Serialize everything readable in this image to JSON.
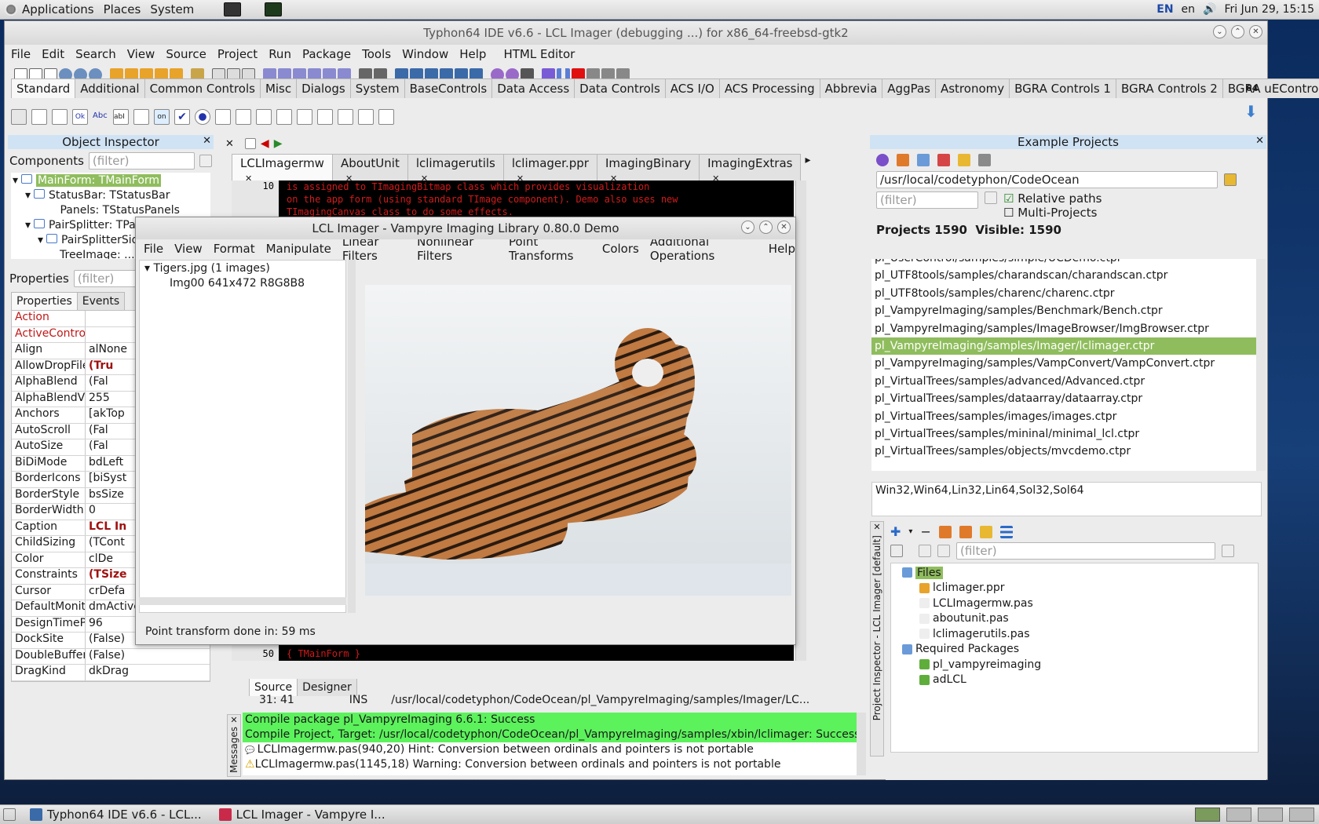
{
  "top_panel": {
    "menu": [
      "Applications",
      "Places",
      "System"
    ],
    "lang1": "EN",
    "lang2": "en",
    "clock": "Fri Jun 29, 15:15"
  },
  "ide": {
    "title": "Typhon64 IDE v6.6 - LCL Imager (debugging ...) for x86_64-freebsd-gtk2",
    "menu": [
      "File",
      "Edit",
      "Search",
      "View",
      "Source",
      "Project",
      "Run",
      "Package",
      "Tools",
      "Window",
      "Help",
      "HTML Editor"
    ],
    "component_tabs": [
      "Standard",
      "Additional",
      "Common Controls",
      "Misc",
      "Dialogs",
      "System",
      "BaseControls",
      "Data Access",
      "Data Controls",
      "ACS I/O",
      "ACS Processing",
      "Abbrevia",
      "AggPas",
      "Astronomy",
      "BGRA Controls 1",
      "BGRA Controls 2",
      "BGRA uEControls"
    ],
    "palette_labels": [
      "Ok",
      "Abc",
      "abI",
      "on"
    ],
    "badge64": "64"
  },
  "object_inspector": {
    "title": "Object Inspector",
    "components_label": "Components",
    "filter_placeholder": "(filter)",
    "tree": [
      "MainForm: TMainForm",
      "StatusBar: TStatusBar",
      "Panels: TStatusPanels",
      "PairSplitter: TPai",
      "PairSplitterSid",
      "TreeImage: ..."
    ],
    "properties_label": "Properties",
    "tabs": [
      "Properties",
      "Events"
    ],
    "props": [
      {
        "n": "Action",
        "v": ""
      },
      {
        "n": "ActiveControl",
        "v": ""
      },
      {
        "n": "Align",
        "v": "alNone"
      },
      {
        "n": "AllowDropFiles",
        "v": "(Tru"
      },
      {
        "n": "AlphaBlend",
        "v": "(Fal"
      },
      {
        "n": "AlphaBlendVal",
        "v": "255"
      },
      {
        "n": "Anchors",
        "v": "[akTop"
      },
      {
        "n": "AutoScroll",
        "v": "(Fal"
      },
      {
        "n": "AutoSize",
        "v": "(Fal"
      },
      {
        "n": "BiDiMode",
        "v": "bdLeft"
      },
      {
        "n": "BorderIcons",
        "v": "[biSyst"
      },
      {
        "n": "BorderStyle",
        "v": "bsSize"
      },
      {
        "n": "BorderWidth",
        "v": "0"
      },
      {
        "n": "Caption",
        "v": "LCL In"
      },
      {
        "n": "ChildSizing",
        "v": "(TCont"
      },
      {
        "n": "Color",
        "v": "clDe"
      },
      {
        "n": "Constraints",
        "v": "(TSize"
      },
      {
        "n": "Cursor",
        "v": "crDefa"
      },
      {
        "n": "DefaultMonito",
        "v": "dmActiveForm"
      },
      {
        "n": "DesignTimePP",
        "v": "96"
      },
      {
        "n": "DockSite",
        "v": "(False)"
      },
      {
        "n": "DoubleBuffere",
        "v": "(False)"
      },
      {
        "n": "DragKind",
        "v": "dkDrag"
      }
    ]
  },
  "editor": {
    "tabs": [
      "LCLImagermw",
      "AboutUnit",
      "lclimagerutils",
      "lclimager.ppr",
      "ImagingBinary",
      "ImagingExtras"
    ],
    "code_lines": [
      "is assigned to TImagingBitmap class which provides visualization",
      "on the app form (using standard TImage component). Demo also uses new",
      "TImagingCanvas class to do some effects."
    ],
    "line_top": "10",
    "line_bottom": "50",
    "bottom_code": "{ TMainForm }",
    "bottom_tabs": [
      "Source",
      "Designer"
    ],
    "status_pos": "31: 41",
    "status_mode": "INS",
    "status_path": "/usr/local/codetyphon/CodeOcean/pl_VampyreImaging/samples/Imager/LC..."
  },
  "imager": {
    "title": "LCL Imager - Vampyre Imaging Library 0.80.0 Demo",
    "menu": [
      "File",
      "View",
      "Format",
      "Manipulate",
      "Linear Filters",
      "Nonlinear Filters",
      "Point Transforms",
      "Colors",
      "Additional Operations",
      "Help"
    ],
    "tree_root": "Tigers.jpg (1 images)",
    "tree_child": "Img00 641x472 R8G8B8",
    "status": "Point transform done in: 59 ms"
  },
  "example_projects": {
    "title": "Example Projects",
    "path": "/usr/local/codetyphon/CodeOcean",
    "filter_placeholder": "(filter)",
    "relative_paths": "Relative paths",
    "multi_projects": "Multi-Projects",
    "counts": "Projects 1590  Visible: 1590",
    "items": [
      "pl_UserControl/samples/simple/UCDemo.ctpr",
      "pl_UTF8tools/samples/charandscan/charandscan.ctpr",
      "pl_UTF8tools/samples/charenc/charenc.ctpr",
      "pl_VampyreImaging/samples/Benchmark/Bench.ctpr",
      "pl_VampyreImaging/samples/ImageBrowser/ImgBrowser.ctpr",
      "pl_VampyreImaging/samples/Imager/lclimager.ctpr",
      "pl_VampyreImaging/samples/VampConvert/VampConvert.ctpr",
      "pl_VirtualTrees/samples/advanced/Advanced.ctpr",
      "pl_VirtualTrees/samples/dataarray/dataarray.ctpr",
      "pl_VirtualTrees/samples/images/images.ctpr",
      "pl_VirtualTrees/samples/mininal/minimal_lcl.ctpr",
      "pl_VirtualTrees/samples/objects/mvcdemo.ctpr"
    ],
    "platforms": "Win32,Win64,Lin32,Lin64,Sol32,Sol64"
  },
  "project_inspector": {
    "side_title": "Project Inspector - LCL Imager [default]",
    "filter_placeholder": "(filter)",
    "files_label": "Files",
    "files": [
      "lclimager.ppr",
      "LCLImagermw.pas",
      "aboutunit.pas",
      "lclimagerutils.pas"
    ],
    "packages_label": "Required Packages",
    "packages": [
      "pl_vampyreimaging",
      "adLCL"
    ]
  },
  "messages": {
    "side_title": "Messages",
    "lines": [
      {
        "t": "Compile package pl_VampyreImaging 6.6.1: Success",
        "k": "ok"
      },
      {
        "t": "Compile Project, Target: /usr/local/codetyphon/CodeOcean/pl_VampyreImaging/samples/xbin/lclimager: Success, Warnin",
        "k": "ok"
      },
      {
        "t": "LCLImagermw.pas(940,20) Hint: Conversion between ordinals and pointers is not portable",
        "k": "hint"
      },
      {
        "t": "LCLImagermw.pas(1145,18) Warning: Conversion between ordinals and pointers is not portable",
        "k": "warn"
      }
    ]
  },
  "taskbar": {
    "items": [
      "Typhon64 IDE v6.6 - LCL...",
      "LCL Imager - Vampyre I..."
    ]
  },
  "colors": {
    "selection_green": "#8fbd5d",
    "success_green": "#5cf25c",
    "panel_title": "#d0e3f5",
    "code_red": "#d31a1a"
  }
}
